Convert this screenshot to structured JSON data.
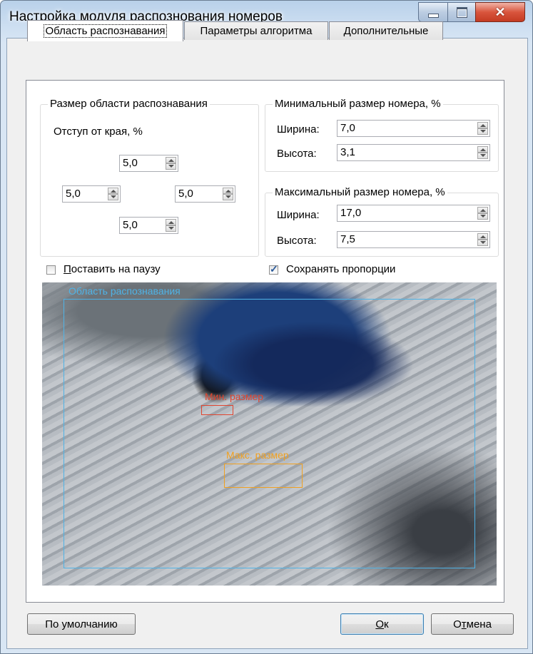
{
  "window": {
    "title": "Настройка модуля распознования номеров"
  },
  "tabs": [
    {
      "label": "Область распознавания",
      "active": true
    },
    {
      "label": "Параметры алгоритма",
      "active": false
    },
    {
      "label": "Дополнительные",
      "active": false
    }
  ],
  "area_group": {
    "legend": "Размер области распознавания",
    "offset_label": "Отступ от края, %",
    "top": "5,0",
    "left": "5,0",
    "right": "5,0",
    "bottom": "5,0"
  },
  "min_group": {
    "legend": "Минимальный размер номера, %",
    "width_label": "Ширина:",
    "width_value": "7,0",
    "height_label": "Высота:",
    "height_value": "3,1"
  },
  "max_group": {
    "legend": "Максимальный размер номера, %",
    "width_label": "Ширина:",
    "width_value": "17,0",
    "height_label": "Высота:",
    "height_value": "7,5"
  },
  "pause": {
    "first": "П",
    "rest": "оставить на паузу",
    "checked": false
  },
  "keep_ratio": {
    "label": "Сохранять пропорции",
    "checked": true
  },
  "overlay": {
    "area_label": "Область распознавания",
    "min_label": "Мин. размер",
    "max_label": "Макс. размер",
    "area_color": "#4fb3e6",
    "min_color": "#e0452f",
    "max_color": "#f0a020"
  },
  "buttons": {
    "defaults": "По умолчанию",
    "ok_first": "О",
    "ok_rest": "к",
    "cancel_a": "О",
    "cancel_b": "т",
    "cancel_c": "мена"
  }
}
